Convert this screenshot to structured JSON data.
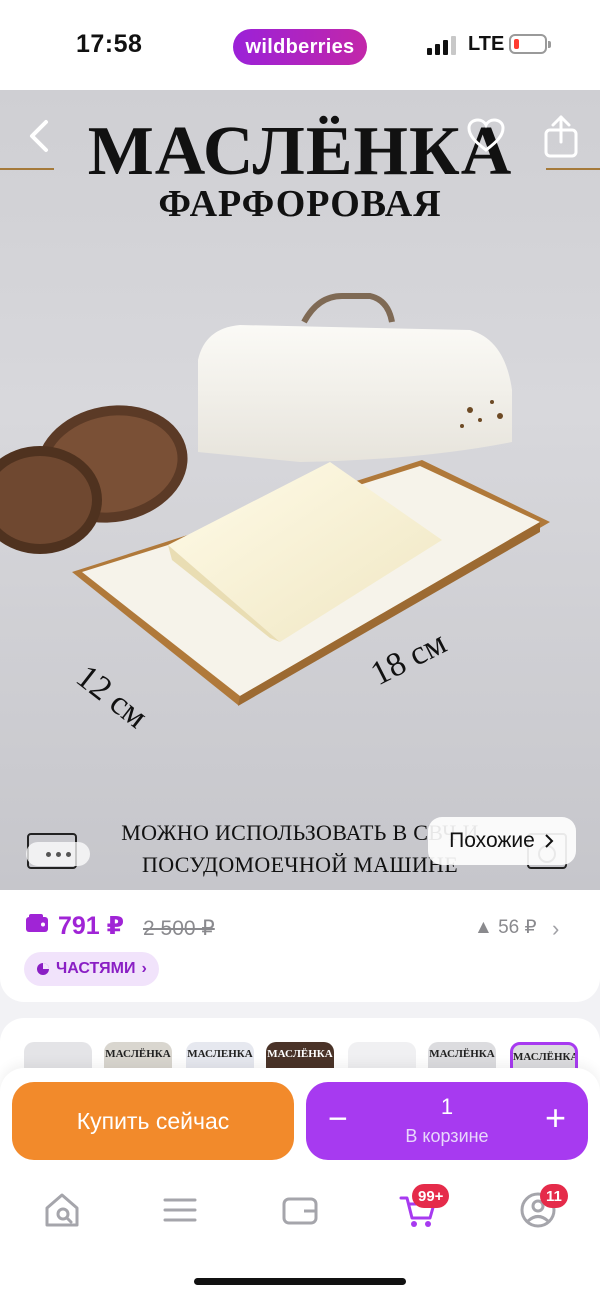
{
  "status_bar": {
    "time": "17:58",
    "app_pill": "wildberries",
    "network": "LTE",
    "battery_level": "low"
  },
  "hero": {
    "title": "МАСЛЁНКА",
    "subtitle": "ФАРФОРОВАЯ",
    "dimension_width": "12 см",
    "dimension_length": "18 см",
    "caption_line1": "МОЖНО ИСПОЛЬЗОВАТЬ В СВЧ И",
    "caption_line2": "ПОСУДОМОЕЧНОЙ МАШИНЕ",
    "similar_button": "Похожие",
    "icons": {
      "back": "chevron-left-icon",
      "favorite": "heart-icon",
      "share": "share-icon"
    }
  },
  "price": {
    "current": "791 ₽",
    "old": "2 500 ₽",
    "drop": "▲ 56 ₽",
    "installments": "ЧАСТЯМИ"
  },
  "thumbnails": [
    {
      "label": ""
    },
    {
      "label": "МАСЛЁНКА"
    },
    {
      "label": "МАСЛЕНКА"
    },
    {
      "label": "МАСЛЁНКА"
    },
    {
      "label": ""
    },
    {
      "label": "МАСЛЁНКА"
    },
    {
      "label": "МАСЛЁНКА"
    }
  ],
  "actions": {
    "buy_now": "Купить сейчас",
    "cart_qty": "1",
    "cart_label": "В корзине",
    "minus": "−",
    "plus": "+"
  },
  "tab_bar": {
    "cart_badge": "99+",
    "profile_badge": "11"
  },
  "colors": {
    "brand_purple": "#a024d6",
    "buy_orange": "#f28a2b",
    "cart_purple": "#a73af0",
    "badge_red": "#e52b4a"
  }
}
